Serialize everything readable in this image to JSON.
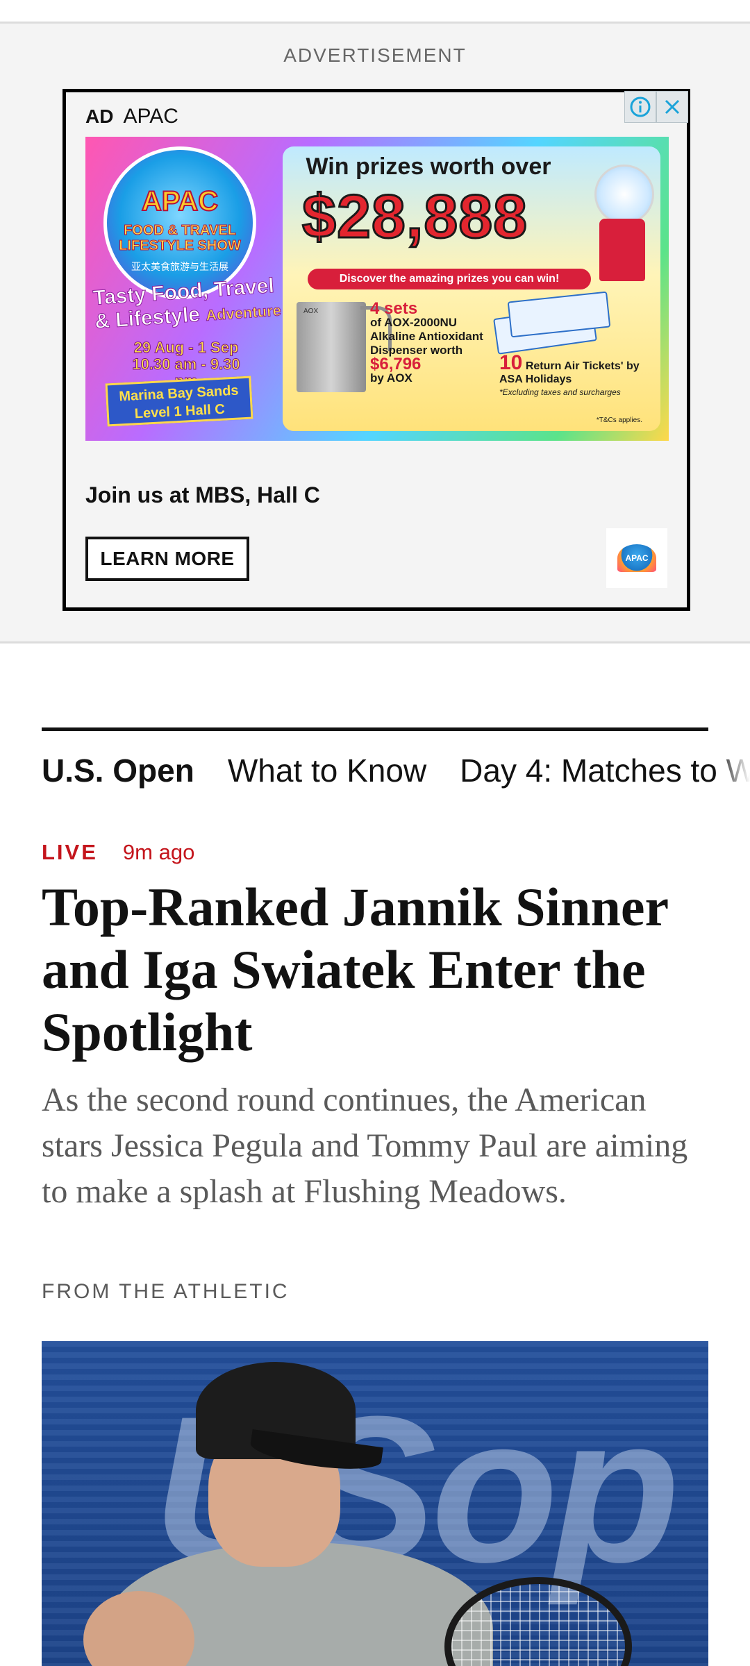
{
  "advertisement": {
    "caption": "ADVERTISEMENT",
    "badge": "AD",
    "advertiser": "APAC",
    "adchoices_icon": "info-icon",
    "close_icon": "close-icon",
    "banner": {
      "logo_title": "APAC",
      "logo_subtitle": "FOOD & TRAVEL LIFESTYLE SHOW",
      "logo_chinese": "亚太美食旅游与生活展",
      "tagline": "Tasty Food, Travel & Lifestyle",
      "tagline_extra": "Adventure",
      "dates": "29 Aug - 1 Sep",
      "hours": "10.30 am - 9.30 pm",
      "venue_line1": "Marina Bay Sands",
      "venue_line2": "Level 1 Hall C",
      "win_text": "Win prizes worth over",
      "prize_amount": "$28,888",
      "discover_text": "Discover the amazing prizes you can win!",
      "prize1_sets": "4 sets",
      "prize1_desc1": "of AOX-2000NU",
      "prize1_desc2": "Alkaline Antioxidant",
      "prize1_desc3": "Dispenser worth",
      "prize1_price": "$6,796",
      "prize1_by": "by AOX",
      "dispenser_brand": "AOX",
      "prize2_count": "10",
      "prize2_desc1": "Return Air Tickets' by",
      "prize2_desc2": "ASA Holidays",
      "prize2_note": "*Excluding taxes and surcharges",
      "tnc": "*T&Cs applies."
    },
    "headline": "Join us at MBS, Hall C",
    "cta": "LEARN MORE",
    "logo_text": "APAC"
  },
  "nav": {
    "items": [
      "U.S. Open",
      "What to Know",
      "Day 4: Matches to W"
    ]
  },
  "article": {
    "live_label": "LIVE",
    "time_ago": "9m ago",
    "headline": "Top-Ranked Jannik Sinner and Iga Swiatek Enter the Spotlight",
    "summary": "As the second round continues, the American stars Jessica Pegula and Tommy Paul are aiming to make a splash at Flushing Meadows.",
    "source": "FROM THE ATHLETIC",
    "photo_background_text": "USop"
  },
  "colors": {
    "live_red": "#c4151c",
    "text": "#121212",
    "muted": "#5a5a5a",
    "ad_background": "#f4f4f4"
  }
}
